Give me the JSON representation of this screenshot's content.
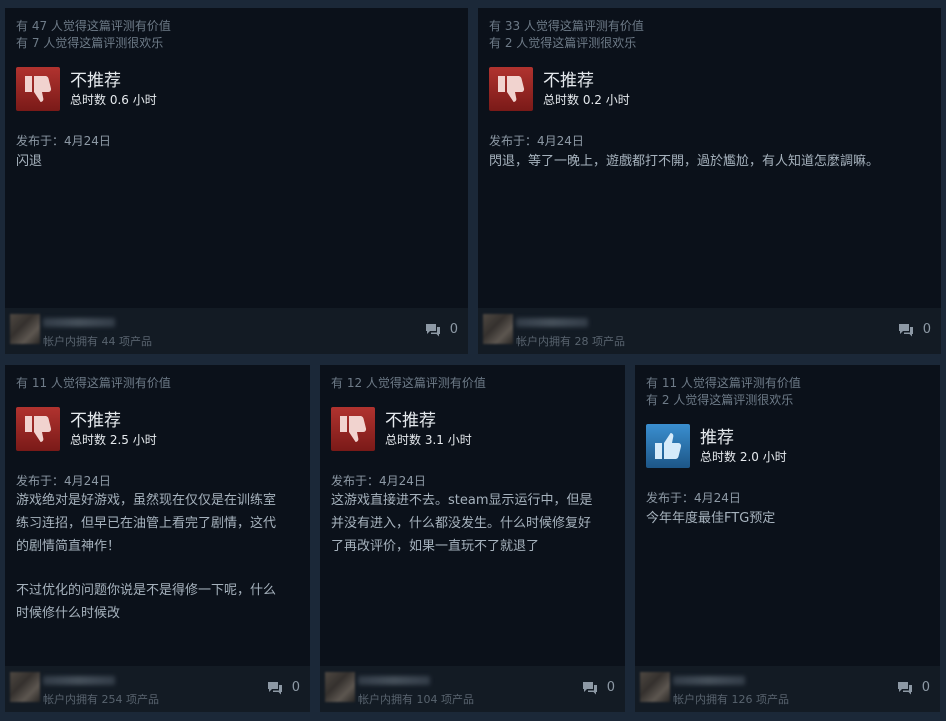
{
  "reviews": [
    {
      "helpful": "有 47 人觉得这篇评测有价值",
      "funny": "有 7 人觉得这篇评测很欢乐",
      "verdict": "不推荐",
      "verdict_icon": "thumbs-down-icon",
      "hours": "总时数 0.6 小时",
      "posted": "发布于：4月24日",
      "text": "闪退",
      "owned": "帐户内拥有 44 项产品",
      "comments": "0"
    },
    {
      "helpful": "有 33 人觉得这篇评测有价值",
      "funny": "有 2 人觉得这篇评测很欢乐",
      "verdict": "不推荐",
      "verdict_icon": "thumbs-down-icon",
      "hours": "总时数 0.2 小时",
      "posted": "发布于：4月24日",
      "text": "閃退，等了一晚上，遊戲都打不開，過於尷尬，有人知道怎麼調嘛。",
      "owned": "帐户内拥有 28 项产品",
      "comments": "0"
    },
    {
      "helpful": "有 11 人觉得这篇评测有价值",
      "verdict": "不推荐",
      "verdict_icon": "thumbs-down-icon",
      "hours": "总时数 2.5 小时",
      "posted": "发布于：4月24日",
      "text_lines": [
        "游戏绝对是好游戏，虽然现在仅仅是在训练室",
        "练习连招，但早已在油管上看完了剧情，这代",
        "的剧情简直神作！",
        "",
        "不过优化的问题你说是不是得修一下呢，什么",
        "时候修什么时候改"
      ],
      "owned": "帐户内拥有 254 项产品",
      "comments": "0"
    },
    {
      "helpful": "有 12 人觉得这篇评测有价值",
      "verdict": "不推荐",
      "verdict_icon": "thumbs-down-icon",
      "hours": "总时数 3.1 小时",
      "posted": "发布于：4月24日",
      "text_lines": [
        "这游戏直接进不去。steam显示运行中，但是",
        "并没有进入，什么都没发生。什么时候修复好",
        "了再改评价，如果一直玩不了就退了"
      ],
      "owned": "帐户内拥有 104 项产品",
      "comments": "0"
    },
    {
      "helpful": "有 11 人觉得这篇评测有价值",
      "funny": "有 2 人觉得这篇评测很欢乐",
      "verdict": "推荐",
      "verdict_icon": "thumbs-up-icon",
      "hours": "总时数 2.0 小时",
      "posted": "发布于：4月24日",
      "text": "今年年度最佳FTG预定",
      "owned": "帐户内拥有 126 项产品",
      "comments": "0"
    }
  ],
  "colors": {
    "page_bg": "#1b2838",
    "card_bg": "#0b111a",
    "footer_bg": "#131b24",
    "thumbs_down": "#b1332f",
    "thumbs_up": "#3a8fd0"
  }
}
